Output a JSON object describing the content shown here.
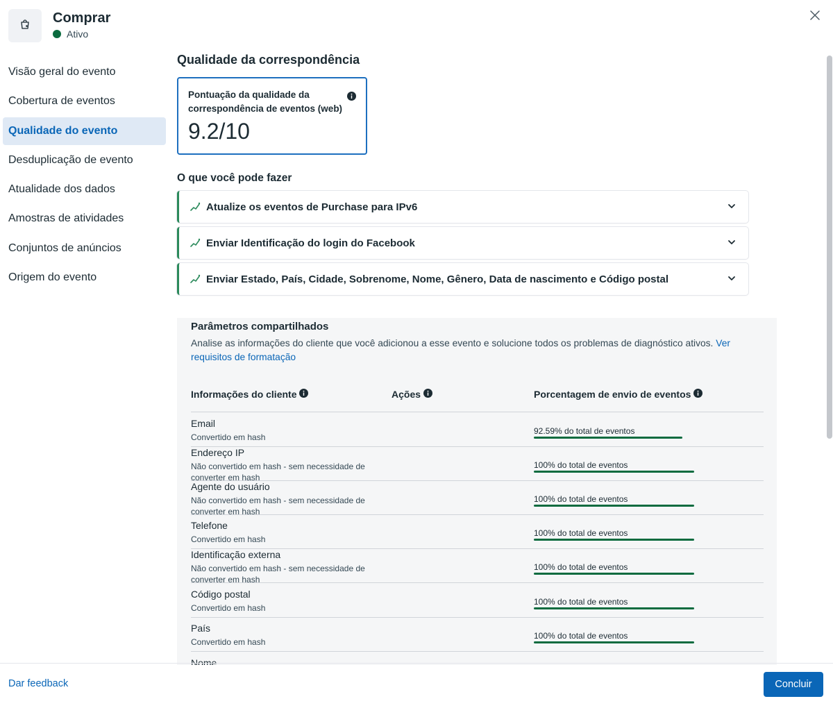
{
  "header": {
    "title": "Comprar",
    "status": "Ativo",
    "status_color": "#0b6b3f",
    "icon": "shopping-bag-icon",
    "close_icon": "close-icon"
  },
  "sidebar": {
    "items": [
      {
        "label": "Visão geral do evento",
        "active": false
      },
      {
        "label": "Cobertura de eventos",
        "active": false
      },
      {
        "label": "Qualidade do evento",
        "active": true
      },
      {
        "label": "Desduplicação de evento",
        "active": false
      },
      {
        "label": "Atualidade dos dados",
        "active": false
      },
      {
        "label": "Amostras de atividades",
        "active": false
      },
      {
        "label": "Conjuntos de anúncios",
        "active": false
      },
      {
        "label": "Origem do evento",
        "active": false
      }
    ]
  },
  "main": {
    "section_title": "Qualidade da correspondência",
    "score": {
      "label": "Pontuação da qualidade da correspondência de eventos (web)",
      "value": "9.2/10"
    },
    "recommendations_title": "O que você pode fazer",
    "recommendations": [
      {
        "label": "Atualize os eventos de Purchase para IPv6"
      },
      {
        "label": "Enviar Identificação do login do Facebook"
      },
      {
        "label": "Enviar Estado, País, Cidade, Sobrenome, Nome, Gênero, Data de nascimento e Código postal"
      }
    ],
    "params": {
      "title": "Parâmetros compartilhados",
      "description": "Analise as informações do cliente que você adicionou a esse evento e solucione todos os problemas de diagnóstico ativos.",
      "link": "Ver requisitos de formatação",
      "columns": [
        "Informações do cliente",
        "Ações",
        "Porcentagem de envio de eventos"
      ],
      "rows": [
        {
          "name": "Email",
          "sub": "Convertido em hash",
          "pct_text": "92.59% do total de eventos",
          "pct": 92.59
        },
        {
          "name": "Endereço IP",
          "sub": "Não convertido em hash - sem necessidade de converter em hash",
          "pct_text": "100% do total de eventos",
          "pct": 100
        },
        {
          "name": "Agente do usuário",
          "sub": "Não convertido em hash - sem necessidade de converter em hash",
          "pct_text": "100% do total de eventos",
          "pct": 100
        },
        {
          "name": "Telefone",
          "sub": "Convertido em hash",
          "pct_text": "100% do total de eventos",
          "pct": 100
        },
        {
          "name": "Identificação externa",
          "sub": "Não convertido em hash - sem necessidade de converter em hash",
          "pct_text": "100% do total de eventos",
          "pct": 100
        },
        {
          "name": "Código postal",
          "sub": "Convertido em hash",
          "pct_text": "100% do total de eventos",
          "pct": 100
        },
        {
          "name": "País",
          "sub": "Convertido em hash",
          "pct_text": "100% do total de eventos",
          "pct": 100
        },
        {
          "name": "Nome",
          "sub": "",
          "pct_text": "",
          "pct": null
        }
      ]
    }
  },
  "footer": {
    "feedback": "Dar feedback",
    "done": "Concluir"
  },
  "colors": {
    "accent": "#0a66b7",
    "success": "#0b6b3f",
    "rec_border": "#2b8a5b"
  }
}
